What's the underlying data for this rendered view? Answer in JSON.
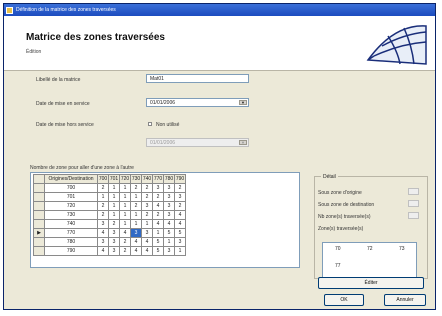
{
  "window": {
    "title": "Définition de la matrice des zones traversées"
  },
  "header": {
    "title": "Matrice des zones traversées",
    "subtitle": "Édition"
  },
  "form": {
    "libelle_label": "Libellé de la matrice",
    "libelle_value": "Mat01",
    "date_mise_label": "Date de mise en service",
    "date_mise_value": "01/01/2006",
    "date_fin_label": "Date de mise hors service",
    "date_fin_check_label": "Non utilisé",
    "date_fin_value": "01/01/2006"
  },
  "grid": {
    "caption": "Nombre de zone pour aller d'une zone à l'autre",
    "origin_header": "Origines/Destination",
    "columns": [
      "700",
      "701",
      "720",
      "730",
      "740",
      "770",
      "780",
      "790"
    ],
    "rows": [
      {
        "origin": "700",
        "values": [
          "2",
          "1",
          "1",
          "2",
          "2",
          "3",
          "3",
          "2"
        ]
      },
      {
        "origin": "701",
        "values": [
          "1",
          "1",
          "1",
          "1",
          "2",
          "2",
          "3",
          "3"
        ]
      },
      {
        "origin": "720",
        "values": [
          "2",
          "1",
          "1",
          "2",
          "3",
          "4",
          "3",
          "2"
        ]
      },
      {
        "origin": "730",
        "values": [
          "2",
          "1",
          "1",
          "1",
          "2",
          "2",
          "3",
          "4"
        ]
      },
      {
        "origin": "740",
        "values": [
          "3",
          "2",
          "1",
          "1",
          "1",
          "4",
          "4",
          "4"
        ]
      },
      {
        "origin": "770",
        "values": [
          "4",
          "3",
          "4",
          "3",
          "3",
          "1",
          "5",
          "5"
        ]
      },
      {
        "origin": "780",
        "values": [
          "3",
          "3",
          "2",
          "4",
          "4",
          "5",
          "1",
          "3"
        ]
      },
      {
        "origin": "790",
        "values": [
          "4",
          "3",
          "2",
          "4",
          "4",
          "5",
          "3",
          "1"
        ]
      }
    ]
  },
  "detail": {
    "group_title": "Détail",
    "zone_origine": "Sous zone d'origine",
    "zone_destination": "Sous zone de destination",
    "nb_zones": "Nb zone(s) traversée(s)",
    "zones_traversees": "Zone(s) traversée(s)",
    "zones": [
      "70",
      "72",
      "73",
      "77"
    ],
    "edit_button": "Éditer"
  },
  "footer": {
    "ok": "OK",
    "cancel": "Annuler"
  }
}
